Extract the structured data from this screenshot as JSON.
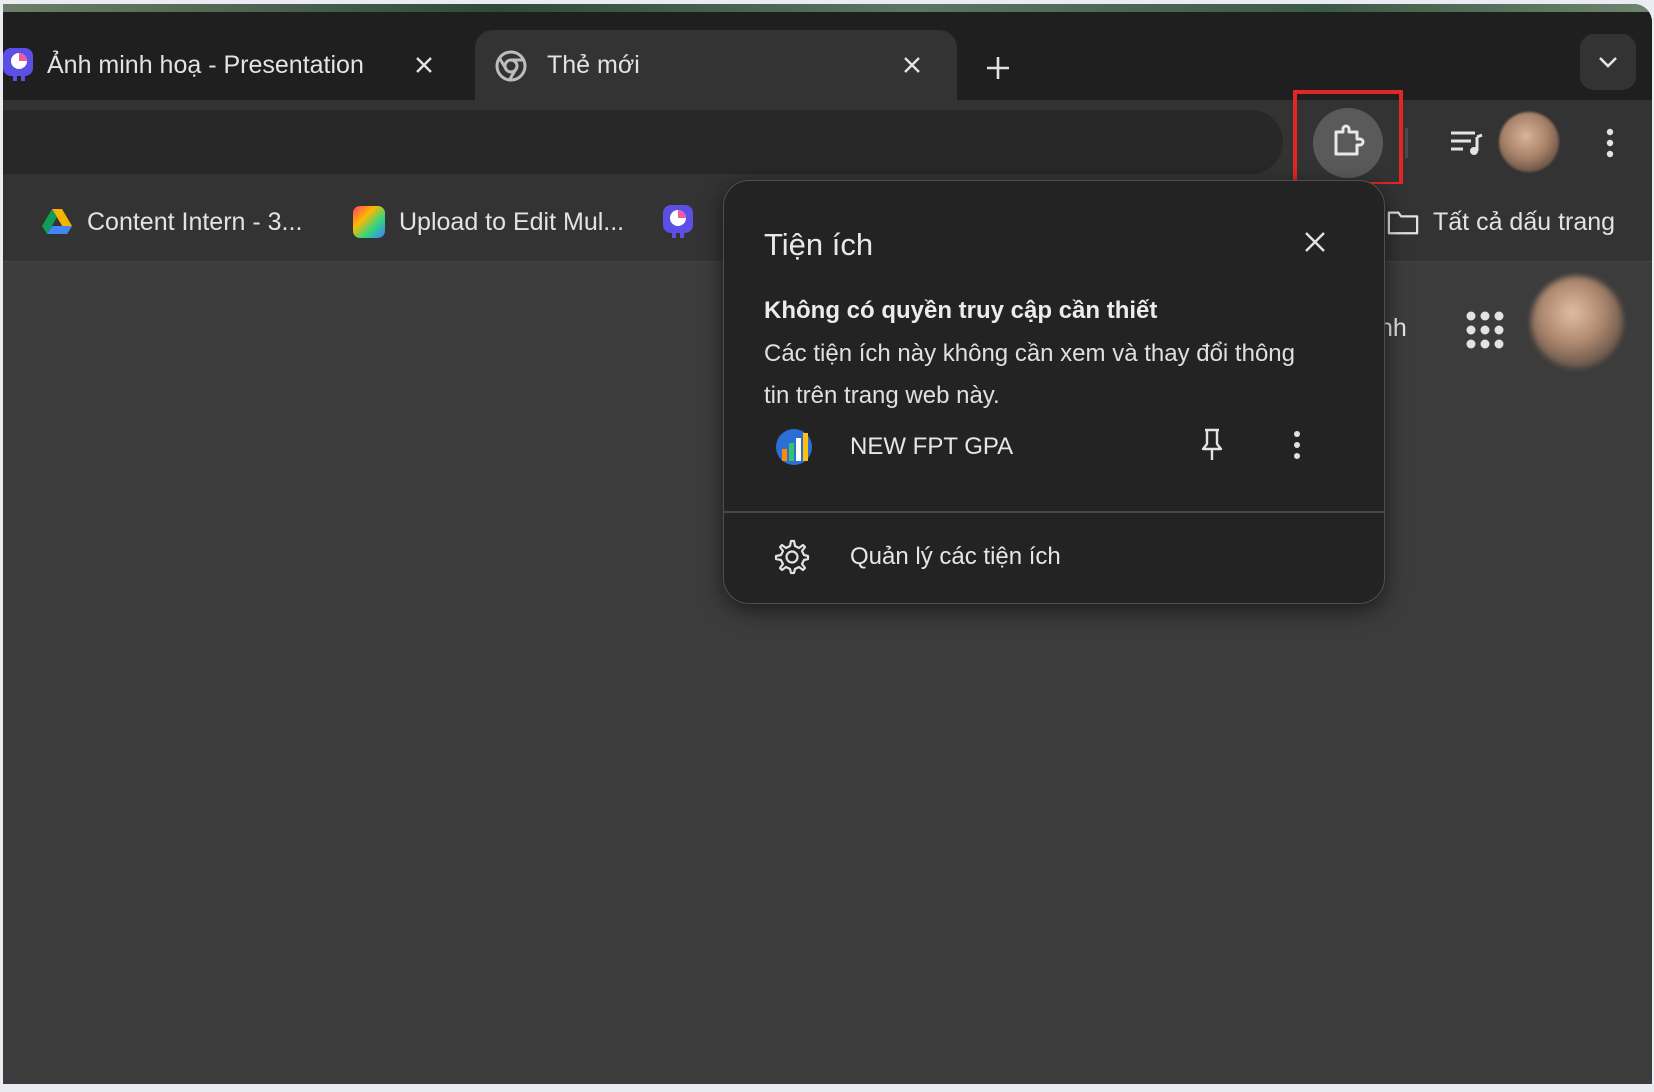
{
  "tabs": [
    {
      "title": "Ảnh minh hoạ - Presentation",
      "active": false
    },
    {
      "title": "Thẻ mới",
      "active": true
    }
  ],
  "bookmarks": {
    "items": [
      {
        "label": "Content Intern - 3..."
      },
      {
        "label": "Upload to Edit Mul..."
      }
    ],
    "all_bookmarks_label": "Tất cả dấu trang"
  },
  "page": {
    "partial_text": "nh"
  },
  "extensions_popup": {
    "title": "Tiện ích",
    "section_heading": "Không có quyền truy cập cần thiết",
    "section_description": "Các tiện ích này không cần xem và thay đổi thông tin trên trang web này.",
    "extensions": [
      {
        "name": "NEW FPT GPA"
      }
    ],
    "manage_label": "Quản lý các tiện ích"
  },
  "colors": {
    "highlight_border": "#e02626",
    "tabstrip_bg": "#1f1f1f",
    "toolbar_bg": "#333333",
    "page_bg": "#3c3c3c"
  },
  "icons": {
    "tab1": "presentation-app-icon",
    "tab2": "chrome-icon",
    "ext_button": "puzzle-extension-icon",
    "media": "media-control-icon",
    "menu": "kebab-menu-icon",
    "apps": "apps-grid-icon",
    "manage": "gear-icon"
  }
}
